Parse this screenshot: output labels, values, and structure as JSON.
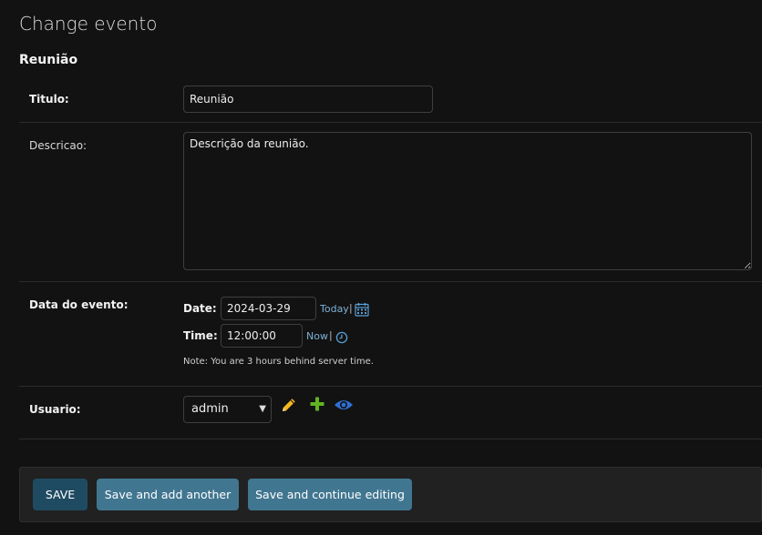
{
  "page": {
    "title": "Change evento"
  },
  "fieldset": {
    "title": "Reunião"
  },
  "fields": {
    "titulo": {
      "label": "Titulo:",
      "value": "Reunião"
    },
    "descricao": {
      "label": "Descricao:",
      "value": "Descrição da reunião."
    },
    "data_evento": {
      "label": "Data do evento:",
      "date_label": "Date:",
      "date_value": "2024-03-29",
      "today_link": "Today",
      "time_label": "Time:",
      "time_value": "12:00:00",
      "now_link": "Now",
      "separator": "|",
      "note": "Note: You are 3 hours behind server time."
    },
    "usuario": {
      "label": "Usuario:",
      "selected": "admin",
      "icons": [
        "pencil-icon",
        "plus-icon",
        "eye-icon"
      ]
    }
  },
  "buttons": {
    "save": "SAVE",
    "save_add_another": "Save and add another",
    "save_continue": "Save and continue editing"
  },
  "colors": {
    "background": "#121212",
    "link": "#7cb1d8",
    "button_primary": "#1f4b62",
    "button_secondary": "#417690",
    "edit_icon": "#f5b720",
    "add_icon": "#5fb623",
    "view_icon": "#2e6fd1"
  }
}
